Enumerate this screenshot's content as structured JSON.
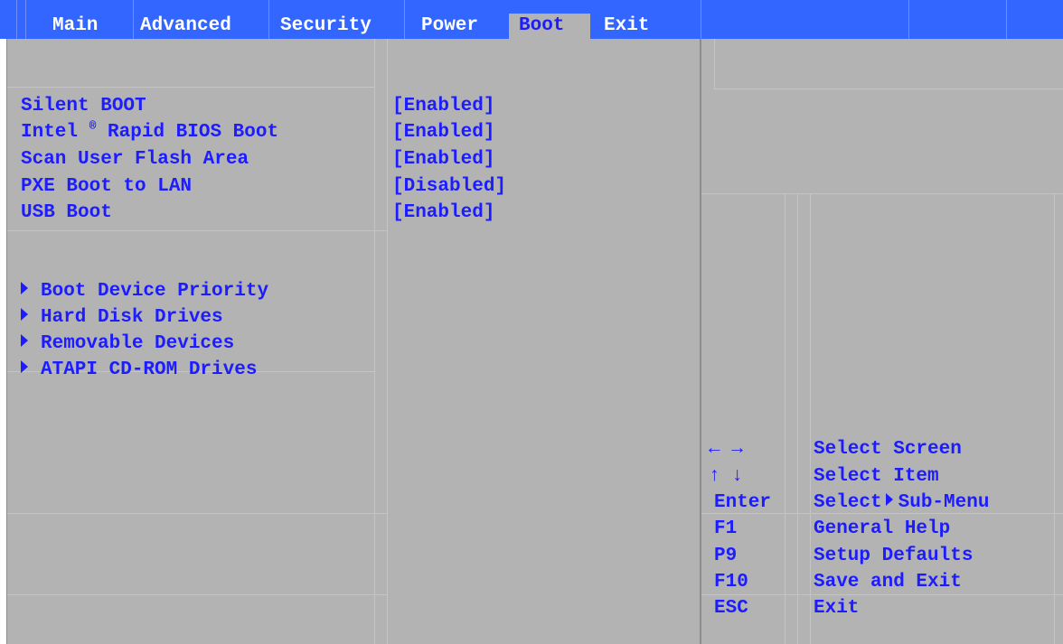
{
  "tabs": [
    {
      "label": "Main"
    },
    {
      "label": "Advanced"
    },
    {
      "label": "Security"
    },
    {
      "label": "Power"
    },
    {
      "label": "Boot"
    },
    {
      "label": "Exit"
    }
  ],
  "active_tab": "Boot",
  "settings": [
    {
      "label": "Silent BOOT",
      "value": "[Enabled]"
    },
    {
      "label_prefix": "Intel",
      "label_sup": "®",
      "label_suffix": "Rapid BIOS Boot",
      "value": "[Enabled]"
    },
    {
      "label": "Scan User Flash Area",
      "value": "[Enabled]"
    },
    {
      "label": "PXE Boot to LAN",
      "value": "[Disabled]"
    },
    {
      "label": "USB Boot",
      "value": "[Enabled]"
    }
  ],
  "submenus": [
    {
      "label": "Boot Device Priority"
    },
    {
      "label": "Hard Disk Drives"
    },
    {
      "label": "Removable Devices"
    },
    {
      "label": "ATAPI CD-ROM Drives"
    }
  ],
  "help_keys": [
    {
      "key": "← →",
      "desc": "Select Screen"
    },
    {
      "key": "↑ ↓",
      "desc": "Select Item"
    },
    {
      "key": "Enter",
      "desc_prefix": "Select",
      "desc_suffix": "Sub-Menu"
    },
    {
      "key": "F1",
      "desc": "General Help"
    },
    {
      "key": "P9",
      "desc": "Setup Defaults"
    },
    {
      "key": "F10",
      "desc": "Save and Exit"
    },
    {
      "key": "ESC",
      "desc": "Exit"
    }
  ],
  "colors": {
    "tab_bar": "#3366ff",
    "panel": "#b3b3b3",
    "text": "#1c1cff",
    "tab_text": "#ffffff"
  },
  "icons": {
    "submenu_marker": "triangle-right-icon"
  }
}
